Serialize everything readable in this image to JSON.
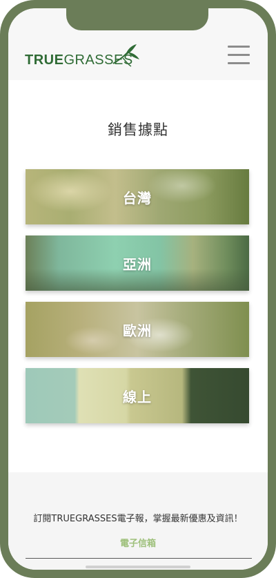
{
  "header": {
    "logo_bold": "TRUE",
    "logo_regular": "GRASSES",
    "colors": {
      "brand_green": "#2f6b35",
      "menu_icon": "#8c8c8c"
    }
  },
  "main": {
    "title": "銷售據點",
    "regions": [
      {
        "label": "台灣"
      },
      {
        "label": "亞洲"
      },
      {
        "label": "歐洲"
      },
      {
        "label": "線上"
      }
    ]
  },
  "footer": {
    "subscribe_text": "訂閱TRUEGRASSES電子報，掌握最新優惠及資訊！",
    "email_label": "電子信箱",
    "email_value": "",
    "accent_color": "#9ec07b"
  },
  "icons": {
    "logo_leaf": "leaf-icon",
    "menu": "hamburger-menu-icon"
  }
}
